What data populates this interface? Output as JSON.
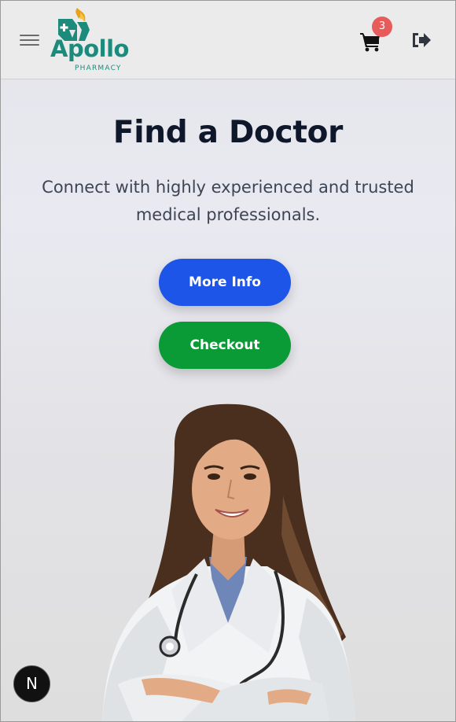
{
  "header": {
    "logo_text": "Apollo",
    "logo_subtext": "PHARMACY",
    "cart_count": "3",
    "icons": {
      "menu": "hamburger-menu-icon",
      "cart": "shopping-cart-icon",
      "logout": "logout-icon"
    }
  },
  "hero": {
    "title": "Find a Doctor",
    "subtitle": "Connect with highly experienced and trusted medical professionals.",
    "more_info_label": "More Info",
    "checkout_label": "Checkout"
  },
  "fab": {
    "label": "N"
  },
  "colors": {
    "brand": "#1d8b7c",
    "brand_accent": "#e8a21c",
    "primary_button": "#1d55e8",
    "checkout_button": "#0a9a36",
    "badge": "#e85b5b",
    "title": "#0f172a"
  }
}
